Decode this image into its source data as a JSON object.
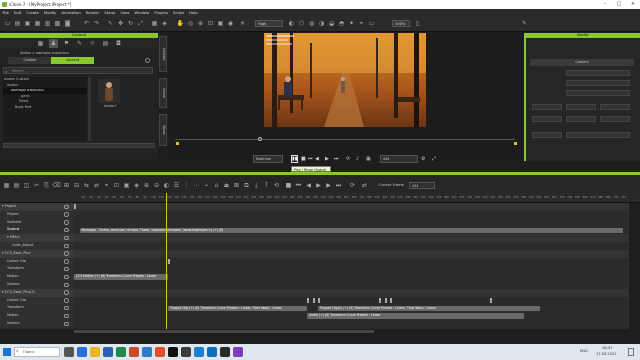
{
  "window": {
    "title": "iClone 7 - [MyProject.iProject *]"
  },
  "menu": [
    "File",
    "Edit",
    "Create",
    "Modify",
    "Animation",
    "Render",
    "Setup",
    "View",
    "Window",
    "Plugins",
    "Script",
    "Help"
  ],
  "toolbar": {
    "quality": "High",
    "zoom": "100%"
  },
  "content": {
    "title": "Content",
    "breadcrumb": "Avatar > аватары взрослых",
    "tabs": [
      "Custom",
      "Content"
    ],
    "search_placeholder": "Search",
    "tree": [
      "Avatar Custom",
      "Avatar",
      "аватары взрослых",
      "дети",
      "Head",
      "Body Part"
    ],
    "thumb_label": "Avatar?"
  },
  "side_tabs": [
    "Content",
    "Scene",
    "Visual"
  ],
  "modify": {
    "title": "Modify",
    "tab": "Camera"
  },
  "playback": {
    "mode": "Realtime",
    "frame": "444",
    "tooltip": "Play / Pause (Space)"
  },
  "timeline": {
    "current_frame_label": "Current Frame",
    "current_frame": "444",
    "ruler": [
      "10",
      "20",
      "30",
      "40",
      "50",
      "60",
      "70",
      "80",
      "90",
      "100",
      "110",
      "120",
      "130",
      "140",
      "150",
      "160",
      "170",
      "180",
      "190",
      "200",
      "210",
      "220",
      "230",
      "240",
      "250",
      "260",
      "270",
      "280",
      "290",
      "300",
      "310",
      "320",
      "330",
      "340",
      "350",
      "360",
      "370",
      "380",
      "390",
      "400",
      "410",
      "420",
      "430",
      "440",
      "450",
      "460",
      "470",
      "480",
      "490",
      "500",
      "510",
      "520",
      "530",
      "540",
      "550",
      "560",
      "570",
      "580",
      "590",
      "600",
      "610",
      "620",
      "630",
      "640",
      "650",
      "660",
      "670",
      "680",
      "690",
      "700",
      "710"
    ],
    "rows": [
      {
        "label": "Project",
        "indent": 0,
        "group": true
      },
      {
        "label": "Project",
        "indent": 1
      },
      {
        "label": "Switcher",
        "indent": 1
      },
      {
        "label": "Sound",
        "indent": 1,
        "bold": true
      },
      {
        "label": "Effect",
        "indent": 1,
        "group": true
      },
      {
        "label": "Color_Adjust",
        "indent": 2
      },
      {
        "label": "CC3_Base_Plus",
        "indent": 0,
        "group": true
      },
      {
        "label": "Collect Clip",
        "indent": 1
      },
      {
        "label": "Transform",
        "indent": 1
      },
      {
        "label": "Motion",
        "indent": 1
      },
      {
        "label": "Viseme",
        "indent": 1
      },
      {
        "label": "CC3_Base_Plus(3)",
        "indent": 0,
        "group": true
      },
      {
        "label": "Collect Clip",
        "indent": 1
      },
      {
        "label": "Transform",
        "indent": 1
      },
      {
        "label": "Motion",
        "indent": 1
      },
      {
        "label": "Viseme",
        "indent": 1
      }
    ],
    "clips": [
      {
        "row": 3,
        "start": 0.01,
        "end": 0.99,
        "text": "Мелодия - Осень, мальчик, гитара. Тихая, хорошая мелодия. (www.hotplayer.ru) (+) (8)"
      },
      {
        "row": 9,
        "start": 0.0,
        "end": 0.17,
        "text": "CC3 Motion (+) (8) Transform Curve Presets : Linear"
      },
      {
        "row": 13,
        "start": 0.17,
        "end": 0.42,
        "text": "Puppet Clip (+) (8) Transform Curve Presets : Linear, Time Warp : Linear"
      },
      {
        "row": 13,
        "start": 0.44,
        "end": 0.84,
        "text": "Puppet Clip(2) (+) (8) Transform Curve Presets : Linear, Time Warp : Linear"
      },
      {
        "row": 14,
        "start": 0.42,
        "end": 0.81,
        "text": "Audio (+) (8) Transform Curve Presets : Linear"
      }
    ]
  },
  "taskbar": {
    "search": "Поиск",
    "time": "16:47",
    "date": "17.03.2021",
    "lang": "ENG"
  }
}
